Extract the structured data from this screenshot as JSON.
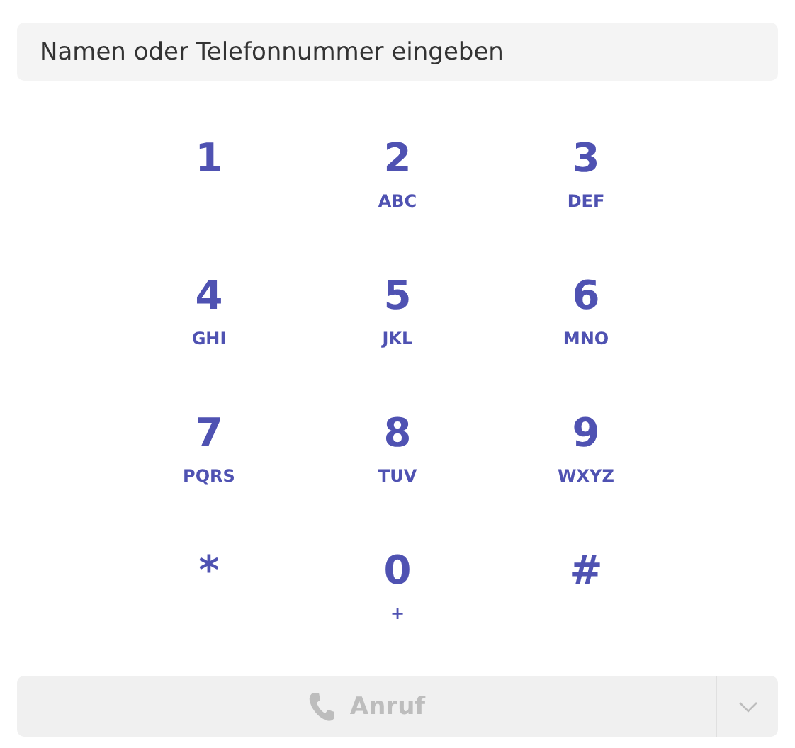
{
  "search": {
    "placeholder": "Namen oder Telefonnummer eingeben"
  },
  "keys": [
    {
      "digit": "1"
    },
    {
      "digit": "2",
      "letters": "ABC"
    },
    {
      "digit": "3",
      "letters": "DEF"
    },
    {
      "digit": "4",
      "letters": "GHI"
    },
    {
      "digit": "5",
      "letters": "JKL"
    },
    {
      "digit": "6",
      "letters": "MNO"
    },
    {
      "digit": "7",
      "letters": "PQRS"
    },
    {
      "digit": "8",
      "letters": "TUV"
    },
    {
      "digit": "9",
      "letters": "WXYZ"
    },
    {
      "digit": "*"
    },
    {
      "digit": "0",
      "letters": "+"
    },
    {
      "digit": "#"
    }
  ],
  "call_button": {
    "label": "Anruf",
    "disabled": true
  }
}
